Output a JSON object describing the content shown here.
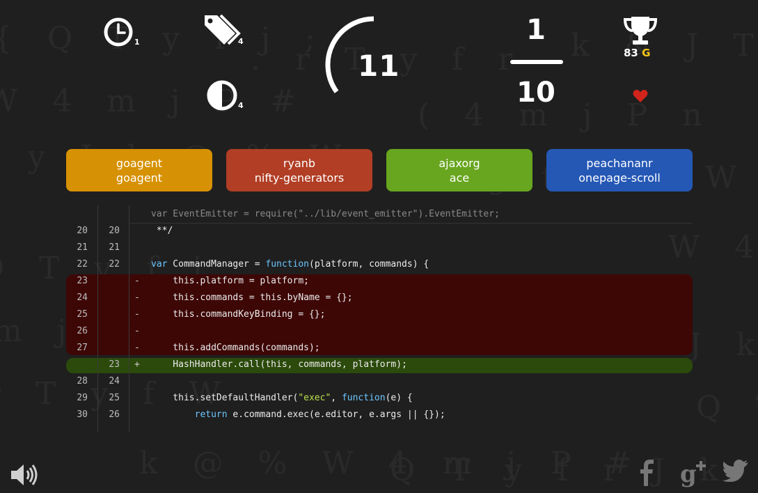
{
  "colors": {
    "choice_1": "#d69104",
    "choice_2": "#b13e25",
    "choice_3": "#68a61f",
    "choice_4": "#2558b5",
    "gold": "#f5c518",
    "heart": "#d1241b"
  },
  "stats": {
    "clock_count": "1",
    "tags_count": "4",
    "contrast_count": "4",
    "timer_value": "11",
    "timer_fraction_remaining": 0.35
  },
  "progress": {
    "numerator": "1",
    "denominator": "10"
  },
  "score": {
    "value": "83",
    "unit": "G"
  },
  "choices": [
    {
      "line1": "goagent",
      "line2": "goagent"
    },
    {
      "line1": "ryanb",
      "line2": "nifty-generators"
    },
    {
      "line1": "ajaxorg",
      "line2": "ace"
    },
    {
      "line1": "peachananr",
      "line2": "onepage-scroll"
    }
  ],
  "diff": {
    "header_line": "var EventEmitter = require(\"../lib/event_emitter\").EventEmitter;",
    "rows": [
      {
        "old": "20",
        "new": "20",
        "marker": "",
        "code": " **/"
      },
      {
        "old": "21",
        "new": "21",
        "marker": "",
        "code": ""
      },
      {
        "old": "22",
        "new": "22",
        "marker": "",
        "code": "var CommandManager = function(platform, commands) {"
      },
      {
        "old": "23",
        "new": "",
        "marker": "-",
        "code": "    this.platform = platform;"
      },
      {
        "old": "24",
        "new": "",
        "marker": "-",
        "code": "    this.commands = this.byName = {};"
      },
      {
        "old": "25",
        "new": "",
        "marker": "-",
        "code": "    this.commandKeyBinding = {};"
      },
      {
        "old": "26",
        "new": "",
        "marker": "-",
        "code": ""
      },
      {
        "old": "27",
        "new": "",
        "marker": "-",
        "code": "    this.addCommands(commands);"
      },
      {
        "old": "",
        "new": "23",
        "marker": "+",
        "code": "    HashHandler.call(this, commands, platform);"
      },
      {
        "old": "28",
        "new": "24",
        "marker": "",
        "code": ""
      },
      {
        "old": "29",
        "new": "25",
        "marker": "",
        "code": "    this.setDefaultHandler(\"exec\", function(e) {"
      },
      {
        "old": "30",
        "new": "26",
        "marker": "",
        "code": "        return e.command.exec(e.editor, e.args || {});"
      }
    ]
  },
  "icons": {
    "clock": "clock-icon",
    "tags": "tags-icon",
    "contrast": "contrast-icon",
    "trophy": "trophy-icon",
    "heart": "heart-icon",
    "sound": "speaker-icon",
    "facebook": "facebook-icon",
    "google_plus": "google-plus-icon",
    "twitter": "twitter-icon"
  }
}
